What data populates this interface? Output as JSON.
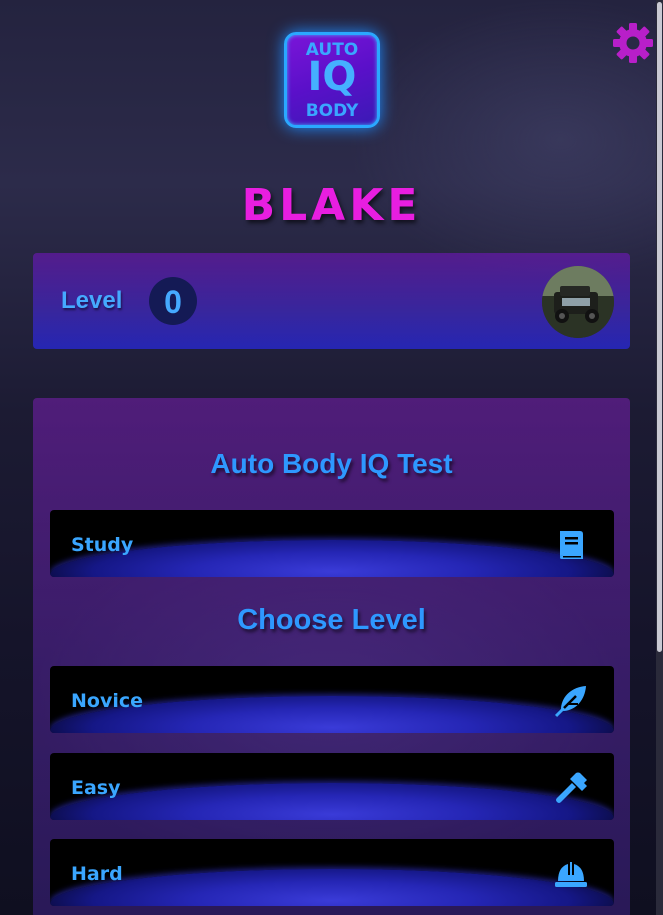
{
  "app": {
    "logo": {
      "line1": "AUTO",
      "line2": "IQ",
      "line3": "BODY"
    }
  },
  "header": {
    "settings_icon": "gear-icon",
    "username": "BLAKE"
  },
  "level_card": {
    "label": "Level",
    "value": "0",
    "avatar_icon": "user-avatar-photo"
  },
  "main": {
    "title": "Auto Body IQ Test",
    "study_button": {
      "label": "Study",
      "icon": "book-icon"
    },
    "choose_level_title": "Choose Level",
    "levels": [
      {
        "label": "Novice",
        "icon": "feather-icon"
      },
      {
        "label": "Easy",
        "icon": "hammer-icon"
      },
      {
        "label": "Hard",
        "icon": "hard-hat-icon"
      }
    ]
  },
  "colors": {
    "accent_blue": "#3aa6ff",
    "username_pink": "#e81ee0",
    "panel_purple": "#7a1ec8"
  }
}
